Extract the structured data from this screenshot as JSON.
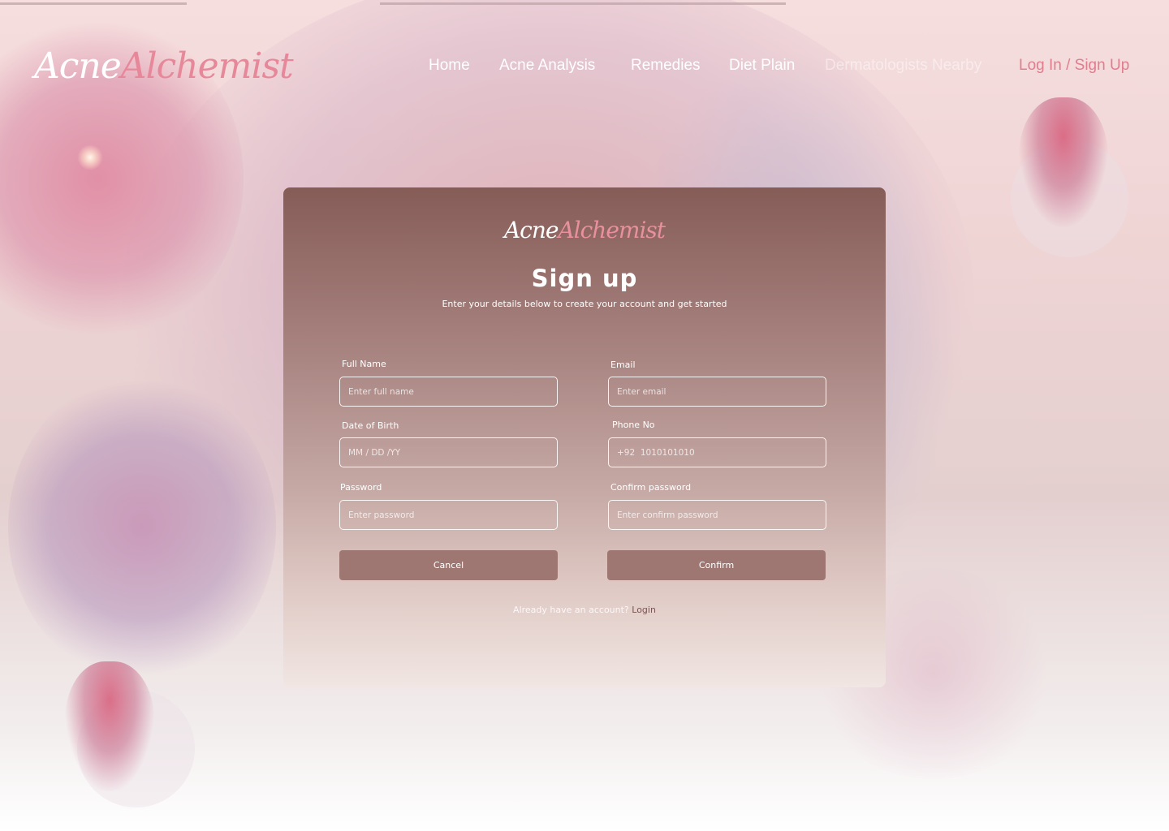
{
  "brand": {
    "word1": "Acne",
    "word2": "Alchemist"
  },
  "nav": {
    "items": [
      {
        "label": "Home"
      },
      {
        "label": "Acne Analysis"
      },
      {
        "label": "Remedies"
      },
      {
        "label": "Diet Plain"
      },
      {
        "label": "Dermatologists Nearby"
      },
      {
        "label": "Log In / Sign Up"
      }
    ]
  },
  "form": {
    "title": "Sign up",
    "subtitle": "Enter your details below to create your account and get started",
    "fields": {
      "full_name": {
        "label": "Full Name",
        "placeholder": "Enter full name",
        "value": ""
      },
      "email": {
        "label": "Email",
        "placeholder": "Enter email",
        "value": ""
      },
      "dob": {
        "label": "Date of Birth",
        "placeholder": "MM / DD /YY",
        "value": ""
      },
      "phone": {
        "label": "Phone No",
        "placeholder": "+92  1010101010",
        "value": ""
      },
      "password": {
        "label": "Password",
        "placeholder": "Enter password",
        "value": ""
      },
      "confirm_password": {
        "label": "Confirm password",
        "placeholder": "Enter confirm password",
        "value": ""
      }
    },
    "cancel_label": "Cancel",
    "confirm_label": "Confirm",
    "footer_prompt": "Already have an account?",
    "footer_link": "Login"
  },
  "colors": {
    "accent": "#e07d8f",
    "button": "#9e7773",
    "card_top": "#865c57",
    "card_bottom": "#f1e6e3"
  }
}
